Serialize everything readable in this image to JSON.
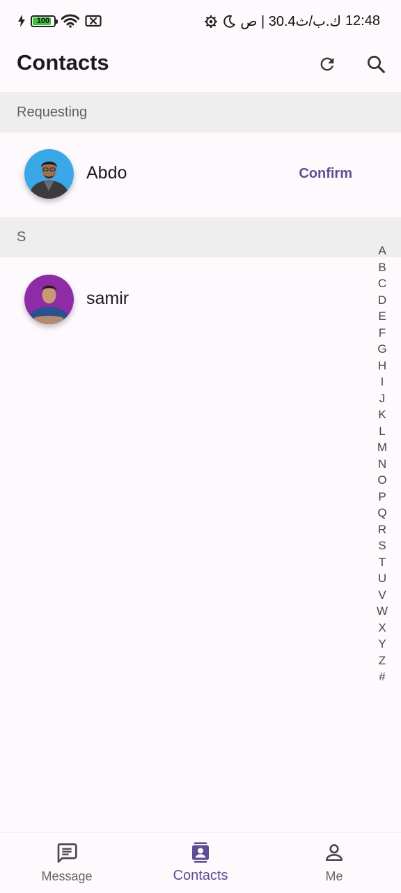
{
  "status_bar": {
    "battery": "100",
    "right_text": "ك.ب/ث30.4 | ص",
    "time": "12:48"
  },
  "header": {
    "title": "Contacts"
  },
  "sections": [
    {
      "title": "Requesting",
      "contacts": [
        {
          "name": "Abdo",
          "action": "Confirm"
        }
      ]
    },
    {
      "title": "S",
      "contacts": [
        {
          "name": "samir"
        }
      ]
    }
  ],
  "alphabet_index": [
    "A",
    "B",
    "C",
    "D",
    "E",
    "F",
    "G",
    "H",
    "I",
    "J",
    "K",
    "L",
    "M",
    "N",
    "O",
    "P",
    "Q",
    "R",
    "S",
    "T",
    "U",
    "V",
    "W",
    "X",
    "Y",
    "Z",
    "#"
  ],
  "nav": [
    {
      "label": "Message",
      "icon": "message-icon"
    },
    {
      "label": "Contacts",
      "icon": "contacts-icon",
      "active": true
    },
    {
      "label": "Me",
      "icon": "person-icon"
    }
  ],
  "colors": {
    "accent": "#5d4e91",
    "section_bg": "#eeeeee",
    "background": "#fdf9fc"
  }
}
